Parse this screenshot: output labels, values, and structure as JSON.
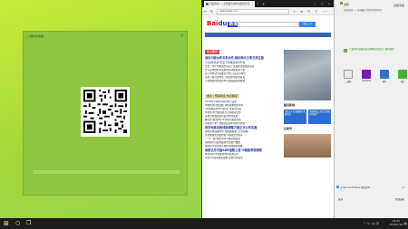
{
  "app_window": {
    "title": "二维码生成器",
    "close": "×"
  },
  "browser": {
    "tab_title": "百度新闻——全球最大的中文新闻平台",
    "url": "news.baidu.com",
    "win_controls": "—  □  ×",
    "tab_close": "×",
    "tab_add": "+"
  },
  "baidu": {
    "logo_bai": "Bai",
    "logo_du": "du",
    "logo_news": "新闻",
    "search_btn": "百度一下",
    "hot_news_label": "热点要闻",
    "headline1": "深化中欧伙伴关系合作,推动两大文明交流互鉴",
    "headline2": "\"打赢攻坚战\"坚定不移推进改革开放",
    "lines": [
      "全文 | 中共中央国务院关于促进经济发展的意见",
      "什么是中国经济发展的新动能和新引擎",
      "北京市启动全民健身计划 打造活力城市",
      "多部门联合发布关于加强市场监管意见",
      "上海推进科技创新中心建设取得新成效"
    ],
    "highlight": "重点 | 聚焦两会 热点解读",
    "sub_headline": "2018年全球经济展望报告发布",
    "more_lines": [
      "市场经济持续回暖 消费需求稳步增长",
      "\"中国制造2025\"助力产业转型升级",
      "外交部:中方愿同各方共同推动合作",
      "多地出台政策支持民营经济发展",
      "教育部:加强中小学生综合素质培养",
      "新能源汽车产销量连续多年位居世界第一"
    ],
    "mid_headline": "西安地铁运营线路调整方案正式公布实施",
    "more_lines2": [
      "国内多地迎来降雪 交通运输部门全力保畅",
      "文化和旅游部发布春节假期出行提示",
      "\"一带一路\"国际合作不断深化拓展",
      "国家统计局发布最新经济运行数据",
      "我国科学家在量子通信领域取得突破"
    ],
    "bottom_headline": "纳斯达克中国ADR指数上涨 中概股表现亮眼",
    "bottom_lines": [
      "体育新闻:中国女排夺得比赛冠军",
      "科技:5G商用进程加快 多地开通试点"
    ],
    "pic_section": "图说新闻",
    "pic_title": "百家号",
    "ad1": "百度云平台 数据服务全面升级",
    "ad2": "百度智能云 助力企业数字化转型"
  },
  "action_center": {
    "title": "通知",
    "subhead": "百度新闻——全球最大的中文新闻平台",
    "clear": "全部清除",
    "desc": "二维码生成器已成功将网址生成为二维码图片",
    "apps": [
      {
        "label": "二维码",
        "color": "#f0f0f0"
      },
      {
        "label": "OneNote",
        "color": "#7719aa"
      },
      {
        "label": "邮件",
        "color": "#2e73c9"
      },
      {
        "label": "微信",
        "color": "#45b035"
      }
    ],
    "store_text": "从 Microsoft Store 获取应用",
    "store_close": "×",
    "bottom_left": "展开",
    "bottom_right": "管理通知"
  },
  "taskbar": {
    "start": "⊞",
    "search": "○",
    "taskview": "❐",
    "tray": "^  ▭  ◁)  中",
    "time": "22:43",
    "date": "2018/1/10",
    "notif": "▤"
  },
  "colors": {
    "desktop": "#a6d83c",
    "app_bg": "#8dc63f",
    "baidu_blue": "#2932e1",
    "baidu_red": "#e10601",
    "taskbar": "#1c1c1c"
  }
}
